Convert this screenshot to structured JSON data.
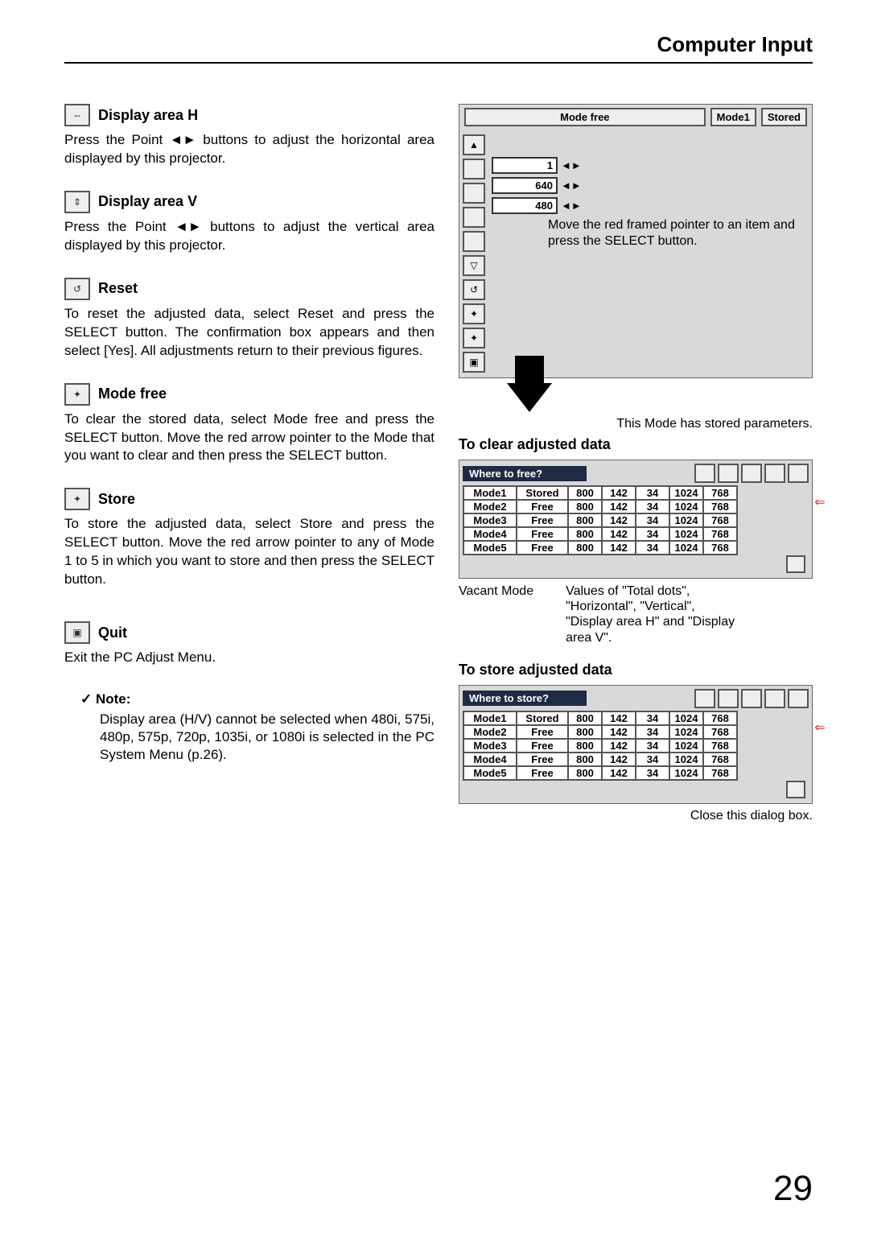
{
  "header": {
    "title": "Computer Input"
  },
  "sections": {
    "displayH": {
      "title": "Display area H",
      "body": "Press the Point ◄► buttons to adjust the horizontal area displayed by this projector."
    },
    "displayV": {
      "title": "Display area V",
      "body": "Press the Point ◄► buttons to adjust the vertical area displayed by this projector."
    },
    "reset": {
      "title": "Reset",
      "body": "To reset the adjusted data, select Reset and press the SELECT button.  The confirmation box appears and then select [Yes].  All adjustments return to their previous figures."
    },
    "modeFree": {
      "title": "Mode free",
      "body": "To clear the stored data, select Mode free and press the SELECT button.  Move the red arrow pointer to the Mode that you want to clear and then press the SELECT button."
    },
    "store": {
      "title": "Store",
      "body": "To store the adjusted data, select Store and press the SELECT button. Move the red arrow pointer to any of Mode 1 to 5 in which you want to store and then press the SELECT button."
    },
    "quit": {
      "title": "Quit",
      "body": "Exit the PC Adjust Menu."
    }
  },
  "note": {
    "heading": "Note:",
    "check": "✓",
    "body": "Display area (H/V) cannot be selected when 480i, 575i, 480p, 575p, 720p, 1035i, or 1080i is selected in the PC System Menu (p.26)."
  },
  "osd_top": {
    "mode_free": "Mode free",
    "mode1": "Mode1",
    "stored": "Stored"
  },
  "osd_params": {
    "v1": "1",
    "v2": "640",
    "v3": "480"
  },
  "osd_instr": "Move the red framed pointer to an item and press the SELECT button.",
  "caption_stored": "This Mode has stored parameters.",
  "clear_title": "To clear adjusted data",
  "store_title": "To store adjusted data",
  "dlg_free": "Where to free?",
  "dlg_store": "Where to store?",
  "table_rows": [
    {
      "mode": "Mode1",
      "status": "Stored",
      "c1": "800",
      "c2": "142",
      "c3": "34",
      "c4": "1024",
      "c5": "768"
    },
    {
      "mode": "Mode2",
      "status": "Free",
      "c1": "800",
      "c2": "142",
      "c3": "34",
      "c4": "1024",
      "c5": "768"
    },
    {
      "mode": "Mode3",
      "status": "Free",
      "c1": "800",
      "c2": "142",
      "c3": "34",
      "c4": "1024",
      "c5": "768"
    },
    {
      "mode": "Mode4",
      "status": "Free",
      "c1": "800",
      "c2": "142",
      "c3": "34",
      "c4": "1024",
      "c5": "768"
    },
    {
      "mode": "Mode5",
      "status": "Free",
      "c1": "800",
      "c2": "142",
      "c3": "34",
      "c4": "1024",
      "c5": "768"
    }
  ],
  "annot": {
    "vacant": "Vacant Mode",
    "values": "Values of \"Total dots\", \"Horizontal\", \"Vertical\", \"Display area H\" and \"Display area V\"."
  },
  "close_note": "Close this dialog box.",
  "page_number": "29"
}
